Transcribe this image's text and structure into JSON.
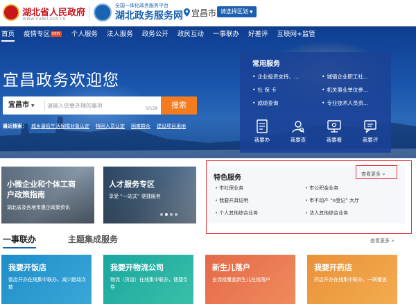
{
  "header": {
    "gov_name": "湖北省人民政府",
    "gov_domain": "WWW.HUBEI.GOV.CN",
    "portal_subtitle": "全国一体化政务服务平台",
    "portal_name": "湖北政务服务网",
    "city": "宜昌市",
    "region_select_label": "请选择区划"
  },
  "nav": {
    "items": [
      {
        "label": "首页"
      },
      {
        "label": "疫情专区"
      },
      {
        "label": "个人服务"
      },
      {
        "label": "法人服务"
      },
      {
        "label": "政务公开"
      },
      {
        "label": "政民互动"
      },
      {
        "label": "一事联办"
      },
      {
        "label": "好差评"
      },
      {
        "label": "互联网+监管"
      }
    ],
    "badge": "NEW"
  },
  "hero": {
    "title": "宜昌政务欢迎您",
    "search": {
      "city": "宜昌市",
      "placeholder": "请输入您要办理的事项",
      "counter": "0/128",
      "button_label": "搜索"
    },
    "hot_label": "最近搜索：",
    "hot_items": [
      "城乡最低生活保障对象认定",
      "特困人员认定",
      "困难群众",
      "建设项目用地"
    ]
  },
  "common_services": {
    "title": "常用服务",
    "links": [
      "企业投资支持、...",
      "城镇企业职工社...",
      "社 保 卡",
      "机关事业单位参...",
      "成绩查询",
      "专业技术人员资..."
    ],
    "quick": [
      {
        "label": "我要办",
        "icon": "apply-icon"
      },
      {
        "label": "我要查",
        "icon": "query-icon"
      },
      {
        "label": "我要看",
        "icon": "view-icon"
      },
      {
        "label": "我要评",
        "icon": "rate-icon"
      }
    ]
  },
  "promos": [
    {
      "title_line1": "小微企业和个体工商",
      "title_line2": "户政策指南",
      "subtitle": "湖北省及各地市惠企政策资讯"
    },
    {
      "title_line1": "人才服务专区",
      "title_line2": "",
      "subtitle": "享受 “一站式” 便捷服务"
    }
  ],
  "featured": {
    "title": "特色服务",
    "more": "查看更多 »",
    "links": [
      "市社保业务",
      "市公积金业务",
      "我要开具证明",
      "市不动产 “e登记” 大厅",
      "个人其他综合业务",
      "法人其他综合业务"
    ]
  },
  "sections": {
    "tab1": "一事联办",
    "tab2": "主题集成服务",
    "more": "查看更多 »"
  },
  "cards": [
    {
      "title": "我要开饭店",
      "desc": "饭店开办在线集中联办，减少跑动次数"
    },
    {
      "title": "我要开物流公司",
      "desc": "物流（货运）在线集中联办，便捷引导"
    },
    {
      "title": "新生儿落户",
      "desc": "全流程覆盖新生儿在线落户"
    },
    {
      "title": "我要开药店",
      "desc": "药店开办在线集中联办，一网覆盖"
    }
  ],
  "colors": {
    "brand_blue": "#1a63b0",
    "gov_red": "#c8161d",
    "search_orange": "#f47c20",
    "highlight_red": "#e2383c"
  }
}
